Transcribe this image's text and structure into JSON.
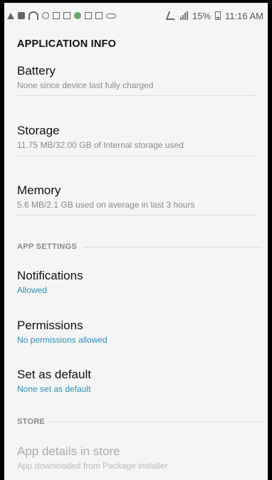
{
  "status_bar": {
    "battery_percent": "15%",
    "time": "11:16 AM",
    "icons": [
      "warning-icon",
      "message-icon",
      "wifi-icon",
      "settings-sync-icon",
      "bluetooth-icon",
      "checkbox-icon",
      "app-icon",
      "image-icon",
      "email-icon",
      "voicemail-icon"
    ]
  },
  "appbar": {
    "title": "APPLICATION INFO"
  },
  "items": [
    {
      "title": "Battery",
      "subtitle": "None since device last fully charged"
    },
    {
      "title": "Storage",
      "subtitle": "11.75 MB/32.00 GB of Internal storage used"
    },
    {
      "title": "Memory",
      "subtitle": "5.6 MB/2.1 GB used on average in last 3 hours"
    }
  ],
  "sections": {
    "app_settings": "APP SETTINGS",
    "store": "STORE"
  },
  "app_settings": [
    {
      "title": "Notifications",
      "subtitle": "Allowed"
    },
    {
      "title": "Permissions",
      "subtitle": "No permissions allowed"
    },
    {
      "title": "Set as default",
      "subtitle": "None set as default"
    }
  ],
  "store": [
    {
      "title": "App details in store",
      "subtitle": "App downloaded from Package installer"
    }
  ]
}
